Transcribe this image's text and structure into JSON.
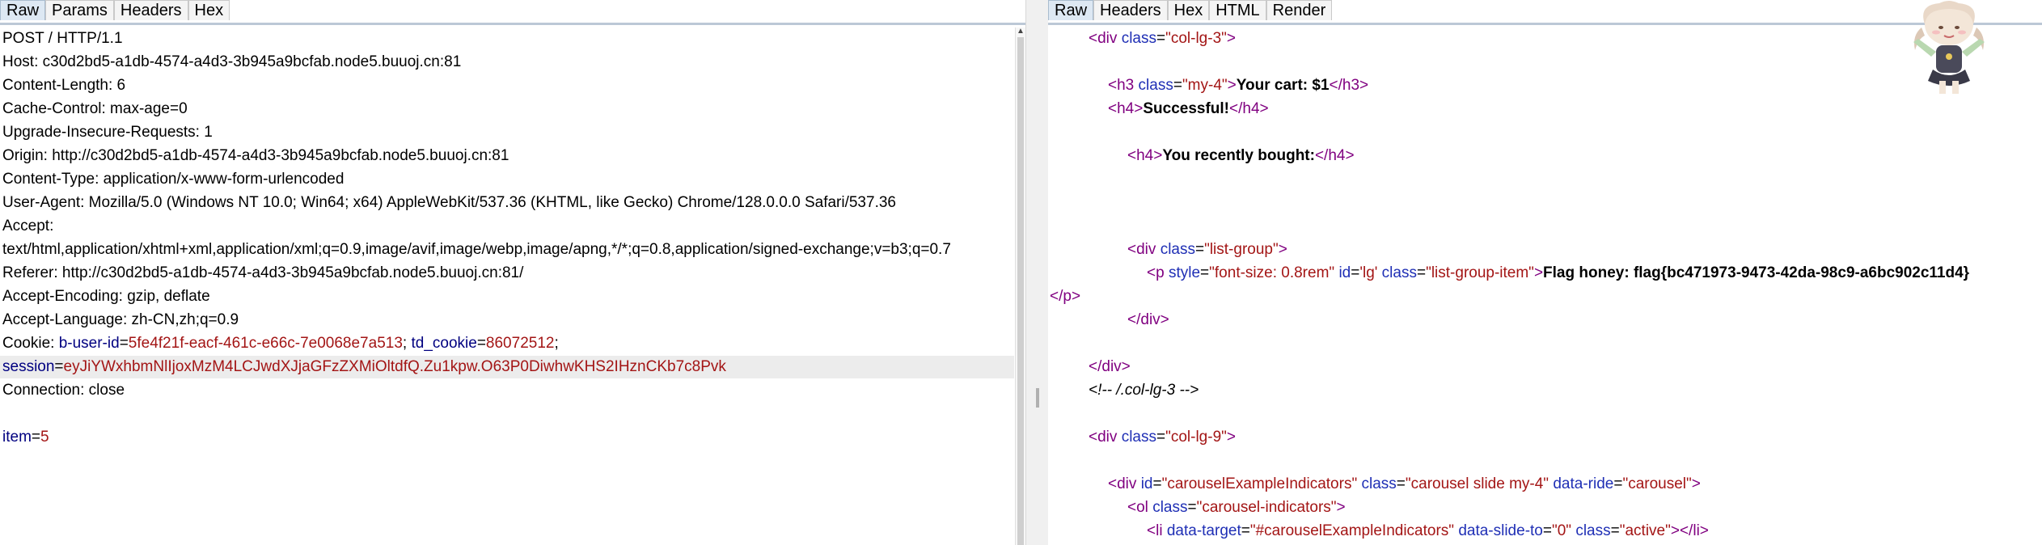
{
  "request": {
    "tabs": [
      "Raw",
      "Params",
      "Headers",
      "Hex"
    ],
    "active_tab": "Raw",
    "lines": {
      "l1": "POST / HTTP/1.1",
      "l2": "Host: c30d2bd5-a1db-4574-a4d3-3b945a9bcfab.node5.buuoj.cn:81",
      "l3": "Content-Length: 6",
      "l4": "Cache-Control: max-age=0",
      "l5": "Upgrade-Insecure-Requests: 1",
      "l6": "Origin: http://c30d2bd5-a1db-4574-a4d3-3b945a9bcfab.node5.buuoj.cn:81",
      "l7": "Content-Type: application/x-www-form-urlencoded",
      "l8": "User-Agent: Mozilla/5.0 (Windows NT 10.0; Win64; x64) AppleWebKit/537.36 (KHTML, like Gecko) Chrome/128.0.0.0 Safari/537.36",
      "l9": "Accept:",
      "l10": "text/html,application/xhtml+xml,application/xml;q=0.9,image/avif,image/webp,image/apng,*/*;q=0.8,application/signed-exchange;v=b3;q=0.7",
      "l11": "Referer: http://c30d2bd5-a1db-4574-a4d3-3b945a9bcfab.node5.buuoj.cn:81/",
      "l12": "Accept-Encoding: gzip, deflate",
      "l13": "Accept-Language: zh-CN,zh;q=0.9",
      "cookie_prefix": "Cookie: ",
      "cookie1_key": "b-user-id",
      "cookie1_val": "5fe4f21f-eacf-461c-e66c-7e0068e7a513",
      "cookie2_key": "td_cookie",
      "cookie2_val": "86072512",
      "session_key": "session",
      "session_val": "eyJiYWxhbmNlIjoxMzM4LCJwdXJjaGFzZXMiOltdfQ.Zu1kpw.O63P0DiwhwKHS2IHznCKb7c8Pvk",
      "l16": "Connection: close",
      "body_key": "item",
      "body_val": "5"
    }
  },
  "response": {
    "tabs": [
      "Raw",
      "Headers",
      "Hex",
      "HTML",
      "Render"
    ],
    "active_tab": "Raw",
    "t": {
      "div": "div",
      "h3": "h3",
      "h4": "h4",
      "p": "p",
      "ol": "ol",
      "li": "li",
      "class": "class",
      "id": "id",
      "style": "style",
      "data_ride": "data-ride",
      "data_target": "data-target",
      "data_slide_to": "data-slide-to",
      "v_col3": "\"col-lg-3\"",
      "v_my4": "\"my-4\"",
      "v_listgroup": "\"list-group\"",
      "v_fontsize": "\"font-size: 0.8rem\"",
      "v_lg": "'lg'",
      "v_lgi": "\"list-group-item\"",
      "v_col9": "\"col-lg-9\"",
      "v_carid": "\"carouselExampleIndicators\"",
      "v_carcls": "\"carousel slide my-4\"",
      "v_carousel": "\"carousel\"",
      "v_carind": "\"carousel-indicators\"",
      "v_hashcar": "\"#carouselExampleIndicators\"",
      "v_zero": "\"0\"",
      "v_active": "\"active\"",
      "cart": "Your cart: $1",
      "success": "Successful!",
      "bought": "You recently bought:",
      "flag": "Flag honey: flag{bc471973-9473-42da-98c9-a6bc902c11d4}",
      "comment": "<!-- /.col-lg-3 -->"
    }
  },
  "colors": {
    "tag": "#800080",
    "attr": "#1f2fb5",
    "value": "#a31515",
    "comment": "#2a9a2a",
    "active_tab": "#dde8f3"
  }
}
